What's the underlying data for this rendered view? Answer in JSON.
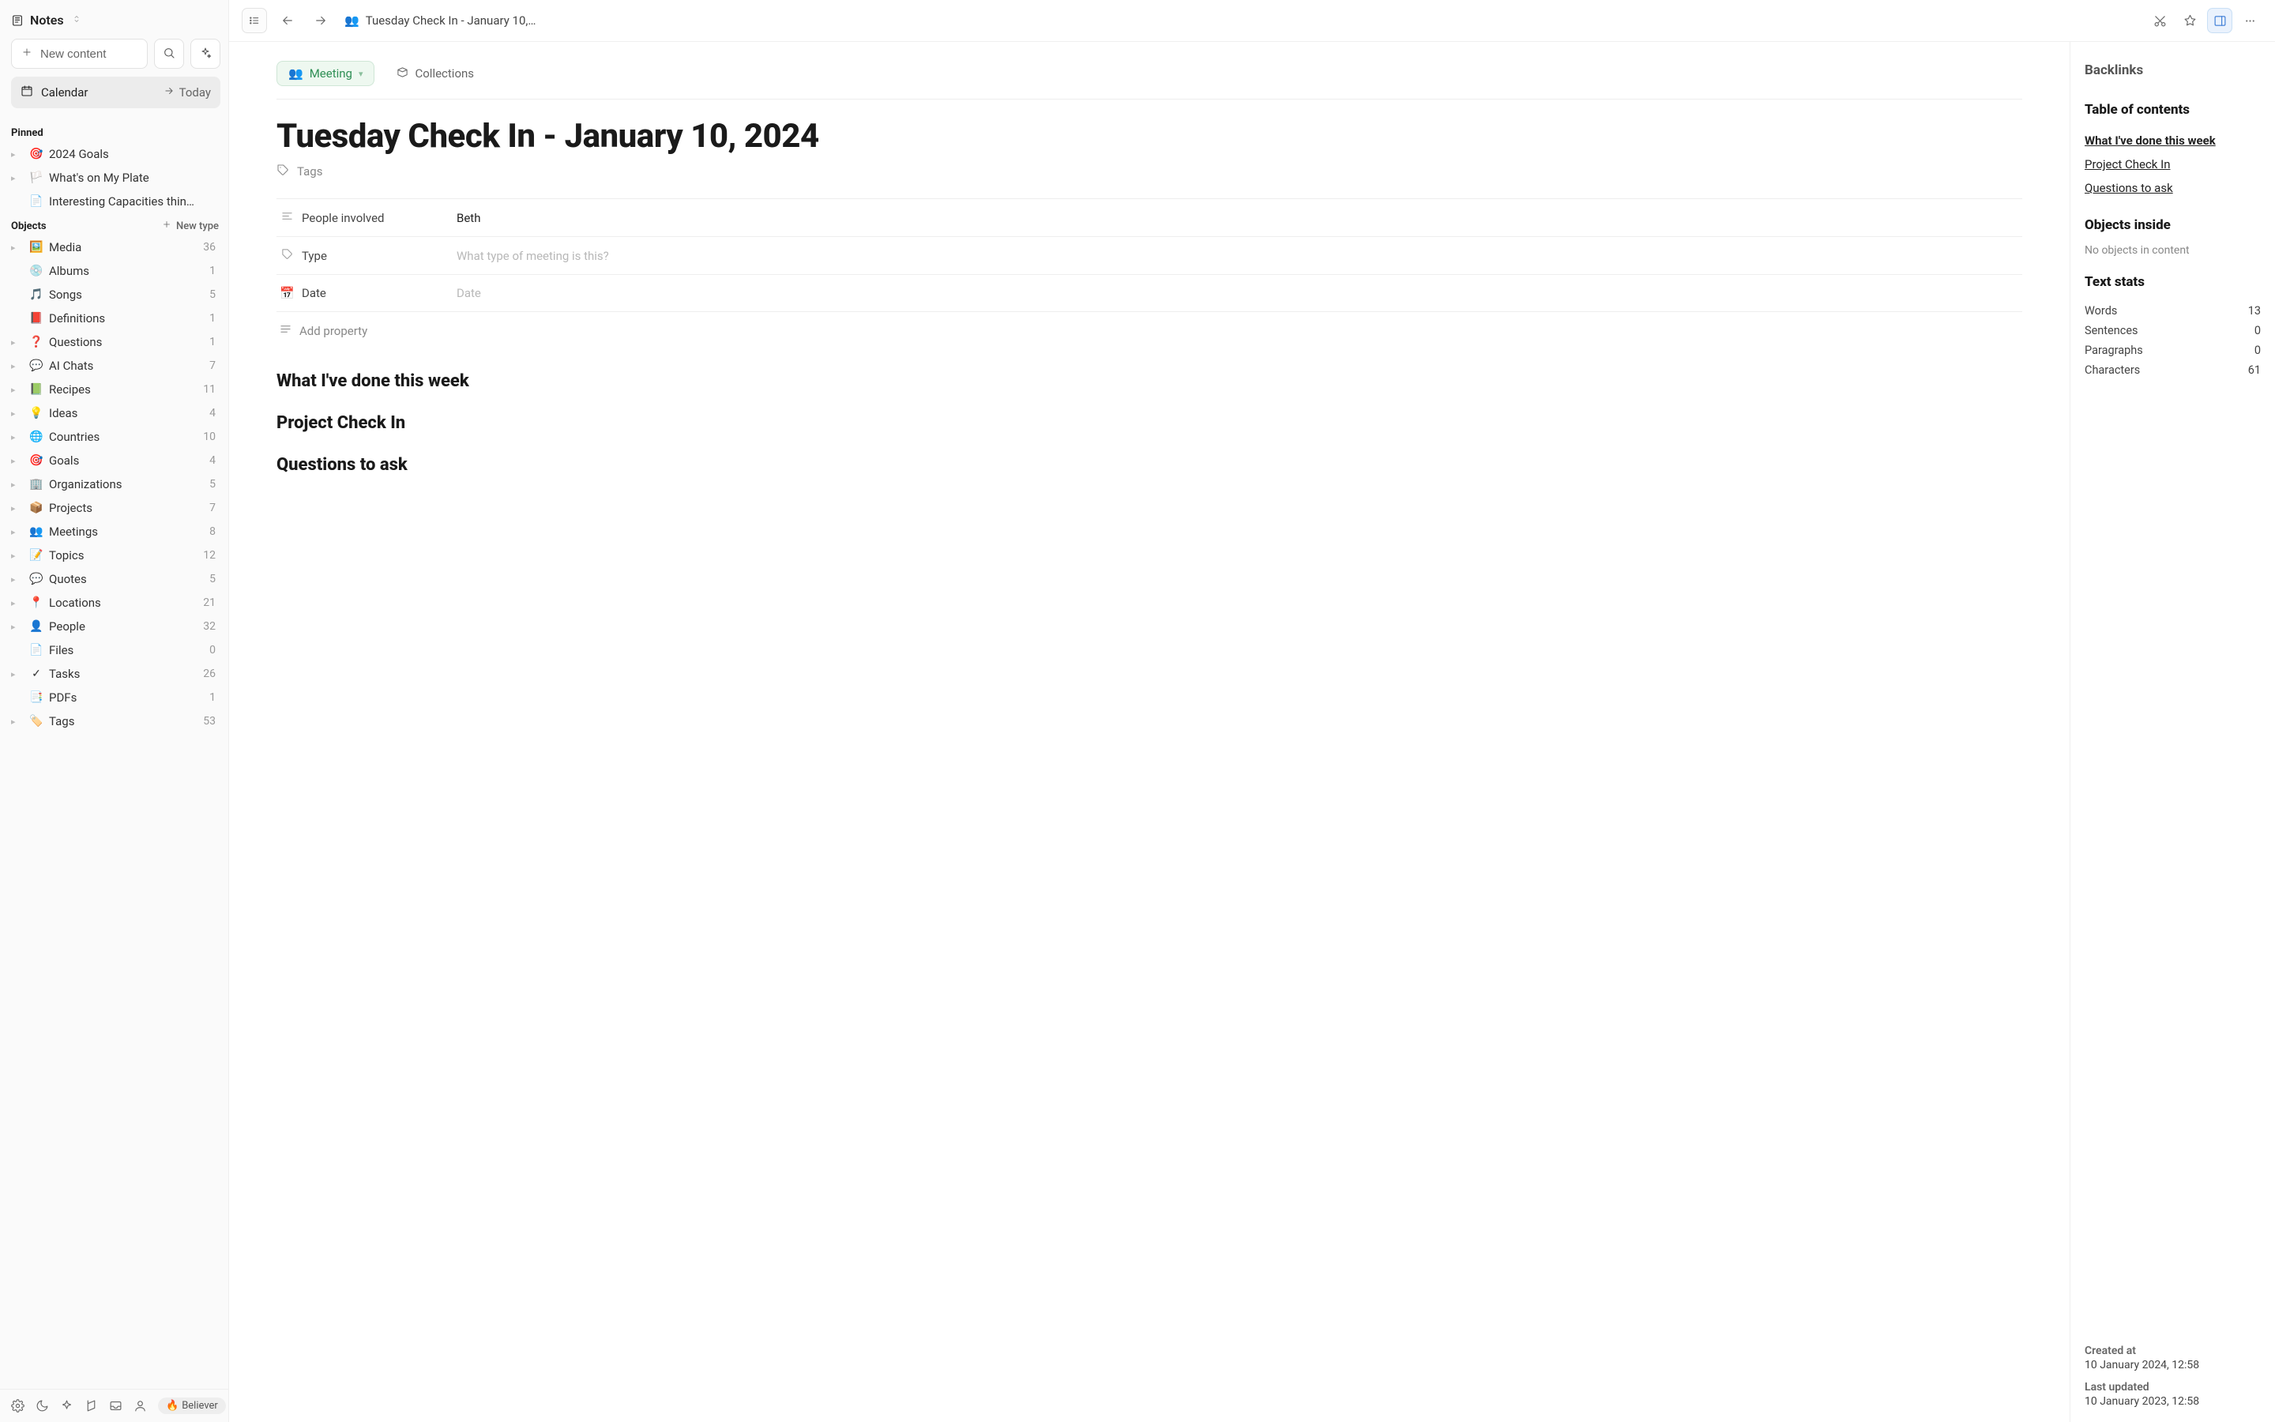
{
  "sidebar": {
    "workspace_label": "Notes",
    "new_content_label": "New content",
    "calendar_label": "Calendar",
    "today_label": "Today",
    "pinned_header": "Pinned",
    "pinned": [
      {
        "icon": "🎯",
        "label": "2024 Goals",
        "expandable": true
      },
      {
        "icon": "🏳️",
        "label": "What's on My Plate",
        "expandable": true
      },
      {
        "icon": "📄",
        "label": "Interesting Capacities thin…",
        "expandable": false
      }
    ],
    "objects_header": "Objects",
    "newtype_label": "New type",
    "objects": [
      {
        "icon": "🖼️",
        "label": "Media",
        "count": "36",
        "expandable": true
      },
      {
        "icon": "💿",
        "label": "Albums",
        "count": "1",
        "expandable": false
      },
      {
        "icon": "🎵",
        "label": "Songs",
        "count": "5",
        "expandable": false
      },
      {
        "icon": "📕",
        "label": "Definitions",
        "count": "1",
        "expandable": false
      },
      {
        "icon": "❓",
        "label": "Questions",
        "count": "1",
        "expandable": true
      },
      {
        "icon": "💬",
        "label": "AI Chats",
        "count": "7",
        "expandable": true
      },
      {
        "icon": "📗",
        "label": "Recipes",
        "count": "11",
        "expandable": true
      },
      {
        "icon": "💡",
        "label": "Ideas",
        "count": "4",
        "expandable": true
      },
      {
        "icon": "🌐",
        "label": "Countries",
        "count": "10",
        "expandable": true
      },
      {
        "icon": "🎯",
        "label": "Goals",
        "count": "4",
        "expandable": true
      },
      {
        "icon": "🏢",
        "label": "Organizations",
        "count": "5",
        "expandable": true
      },
      {
        "icon": "📦",
        "label": "Projects",
        "count": "7",
        "expandable": true
      },
      {
        "icon": "👥",
        "label": "Meetings",
        "count": "8",
        "expandable": true
      },
      {
        "icon": "📝",
        "label": "Topics",
        "count": "12",
        "expandable": true
      },
      {
        "icon": "💬",
        "label": "Quotes",
        "count": "5",
        "expandable": true
      },
      {
        "icon": "📍",
        "label": "Locations",
        "count": "21",
        "expandable": true
      },
      {
        "icon": "👤",
        "label": "People",
        "count": "32",
        "expandable": true
      },
      {
        "icon": "📄",
        "label": "Files",
        "count": "0",
        "expandable": false
      },
      {
        "icon": "✓",
        "label": "Tasks",
        "count": "26",
        "expandable": true
      },
      {
        "icon": "📑",
        "label": "PDFs",
        "count": "1",
        "expandable": false
      },
      {
        "icon": "🏷️",
        "label": "Tags",
        "count": "53",
        "expandable": true
      }
    ],
    "believer_label": "Believer"
  },
  "topbar": {
    "crumb_icon": "👥",
    "crumb_text": "Tuesday Check In - January 10,…"
  },
  "doc": {
    "chip_meeting": "Meeting",
    "chip_collections": "Collections",
    "title": "Tuesday Check In - January 10, 2024",
    "tags_label": "Tags",
    "props": {
      "people_label": "People involved",
      "people_value": "Beth",
      "type_label": "Type",
      "type_placeholder": "What type of meeting is this?",
      "date_label": "Date",
      "date_placeholder": "Date"
    },
    "add_property": "Add property",
    "h2_1": "What I've done this week",
    "h2_2": "Project Check In",
    "h2_3": "Questions to ask"
  },
  "rpanel": {
    "backlinks_h": "Backlinks",
    "toc_h": "Table of contents",
    "toc": [
      "What I've done this week",
      "Project Check In",
      "Questions to ask"
    ],
    "objects_inside_h": "Objects inside",
    "objects_inside_empty": "No objects in content",
    "textstats_h": "Text stats",
    "stats": [
      {
        "label": "Words",
        "value": "13"
      },
      {
        "label": "Sentences",
        "value": "0"
      },
      {
        "label": "Paragraphs",
        "value": "0"
      },
      {
        "label": "Characters",
        "value": "61"
      }
    ],
    "created_label": "Created at",
    "created_value": "10 January 2024, 12:58",
    "updated_label": "Last updated",
    "updated_value": "10 January 2023, 12:58"
  }
}
